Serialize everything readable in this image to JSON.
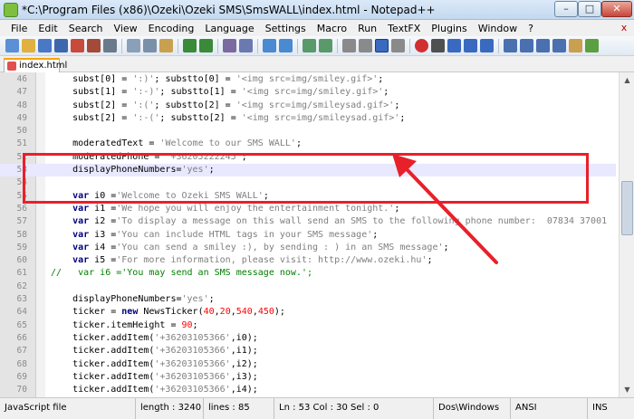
{
  "window": {
    "title": "*C:\\Program Files (x86)\\Ozeki\\Ozeki SMS\\SmsWALL\\index.html - Notepad++",
    "min_glyph": "–",
    "max_glyph": "□",
    "close_glyph": "✕"
  },
  "menu": [
    "File",
    "Edit",
    "Search",
    "View",
    "Encoding",
    "Language",
    "Settings",
    "Macro",
    "Run",
    "TextFX",
    "Plugins",
    "Window",
    "?"
  ],
  "menu_close_glyph": "x",
  "tab": {
    "label": "index.html"
  },
  "editor": {
    "lines": [
      {
        "n": "46",
        "parts": [
          [
            "",
            "    subst[0] = "
          ],
          [
            "str",
            "':)'"
          ],
          [
            "",
            "; substto[0] = "
          ],
          [
            "str",
            "'<img src=img/smiley.gif>'"
          ],
          [
            "",
            ";"
          ]
        ]
      },
      {
        "n": "47",
        "parts": [
          [
            "",
            "    subst[1] = "
          ],
          [
            "str",
            "':-)'"
          ],
          [
            "",
            "; substto[1] = "
          ],
          [
            "str",
            "'<img src=img/smiley.gif>'"
          ],
          [
            "",
            ";"
          ]
        ]
      },
      {
        "n": "48",
        "parts": [
          [
            "",
            "    subst[2] = "
          ],
          [
            "str",
            "':('"
          ],
          [
            "",
            "; substto[2] = "
          ],
          [
            "str",
            "'<img src=img/smileysad.gif>'"
          ],
          [
            "",
            ";"
          ]
        ]
      },
      {
        "n": "49",
        "parts": [
          [
            "",
            "    subst[2] = "
          ],
          [
            "str",
            "':-('"
          ],
          [
            "",
            "; substto[2] = "
          ],
          [
            "str",
            "'<img src=img/smileysad.gif>'"
          ],
          [
            "",
            ";"
          ]
        ]
      },
      {
        "n": "50",
        "parts": [
          [
            "",
            ""
          ]
        ]
      },
      {
        "n": "51",
        "parts": [
          [
            "",
            "    moderatedText = "
          ],
          [
            "str",
            "'Welcome to our SMS WALL'"
          ],
          [
            "",
            ";"
          ]
        ]
      },
      {
        "n": "52",
        "parts": [
          [
            "",
            "    moderatedPhone = "
          ],
          [
            "str",
            "'+36205222245'"
          ],
          [
            "",
            ";"
          ]
        ]
      },
      {
        "n": "53",
        "current": true,
        "parts": [
          [
            "",
            "    displayPhoneNumbers="
          ],
          [
            "str",
            "'yes'"
          ],
          [
            "",
            ";"
          ]
        ]
      },
      {
        "n": "54",
        "parts": [
          [
            "",
            ""
          ]
        ]
      },
      {
        "n": "55",
        "parts": [
          [
            "kw",
            "    var"
          ],
          [
            "",
            " i0 ="
          ],
          [
            "str",
            "'Welcome to Ozeki SMS WALL'"
          ],
          [
            "",
            ";"
          ]
        ]
      },
      {
        "n": "56",
        "parts": [
          [
            "kw",
            "    var"
          ],
          [
            "",
            " i1 ="
          ],
          [
            "str",
            "'We hope you will enjoy the entertainment tonight.'"
          ],
          [
            "",
            ";"
          ]
        ]
      },
      {
        "n": "57",
        "parts": [
          [
            "kw",
            "    var"
          ],
          [
            "",
            " i2 ="
          ],
          [
            "str",
            "'To display a message on this wall send an SMS to the following phone number:  07834 37001"
          ]
        ]
      },
      {
        "n": "58",
        "parts": [
          [
            "kw",
            "    var"
          ],
          [
            "",
            " i3 ="
          ],
          [
            "str",
            "'You can include HTML tags in your SMS message'"
          ],
          [
            "",
            ";"
          ]
        ]
      },
      {
        "n": "59",
        "parts": [
          [
            "kw",
            "    var"
          ],
          [
            "",
            " i4 ="
          ],
          [
            "str",
            "'You can send a smiley :), by sending : ) in an SMS message'"
          ],
          [
            "",
            ";"
          ]
        ]
      },
      {
        "n": "60",
        "parts": [
          [
            "kw",
            "    var"
          ],
          [
            "",
            " i5 ="
          ],
          [
            "str",
            "'For more information, please visit: http://www.ozeki.hu'"
          ],
          [
            "",
            ";"
          ]
        ]
      },
      {
        "n": "61",
        "parts": [
          [
            "com",
            "//   var i6 ='You may send an SMS message now.';"
          ]
        ]
      },
      {
        "n": "62",
        "parts": [
          [
            "",
            ""
          ]
        ]
      },
      {
        "n": "63",
        "parts": [
          [
            "",
            "    displayPhoneNumbers="
          ],
          [
            "str",
            "'yes'"
          ],
          [
            "",
            ";"
          ]
        ]
      },
      {
        "n": "64",
        "parts": [
          [
            "",
            "    ticker = "
          ],
          [
            "kw",
            "new"
          ],
          [
            "",
            " NewsTicker("
          ],
          [
            "num",
            "40"
          ],
          [
            "",
            ","
          ],
          [
            "num",
            "20"
          ],
          [
            "",
            ","
          ],
          [
            "num",
            "540"
          ],
          [
            "",
            ","
          ],
          [
            "num",
            "450"
          ],
          [
            "",
            ");"
          ]
        ]
      },
      {
        "n": "65",
        "parts": [
          [
            "",
            "    ticker.itemHeight = "
          ],
          [
            "num",
            "90"
          ],
          [
            "",
            ";"
          ]
        ]
      },
      {
        "n": "66",
        "parts": [
          [
            "",
            "    ticker.addItem("
          ],
          [
            "str",
            "'+36203105366'"
          ],
          [
            "",
            ",i0);"
          ]
        ]
      },
      {
        "n": "67",
        "parts": [
          [
            "",
            "    ticker.addItem("
          ],
          [
            "str",
            "'+36203105366'"
          ],
          [
            "",
            ",i1);"
          ]
        ]
      },
      {
        "n": "68",
        "parts": [
          [
            "",
            "    ticker.addItem("
          ],
          [
            "str",
            "'+36203105366'"
          ],
          [
            "",
            ",i2);"
          ]
        ]
      },
      {
        "n": "69",
        "parts": [
          [
            "",
            "    ticker.addItem("
          ],
          [
            "str",
            "'+36203105366'"
          ],
          [
            "",
            ",i3);"
          ]
        ]
      },
      {
        "n": "70",
        "parts": [
          [
            "",
            "    ticker.addItem("
          ],
          [
            "str",
            "'+36203105366'"
          ],
          [
            "",
            ",i4);"
          ]
        ]
      }
    ]
  },
  "status": {
    "language": "JavaScript file",
    "length": "length : 3240",
    "lines": "lines : 85",
    "position": "Ln : 53   Col : 30   Sel : 0",
    "eol": "Dos\\Windows",
    "encoding": "ANSI",
    "mode": "INS"
  },
  "colors": {
    "annotation_red": "#e8202a",
    "string": "#7f7f7f",
    "keyword": "#00007f",
    "number": "#ff0000",
    "comment": "#008000"
  }
}
